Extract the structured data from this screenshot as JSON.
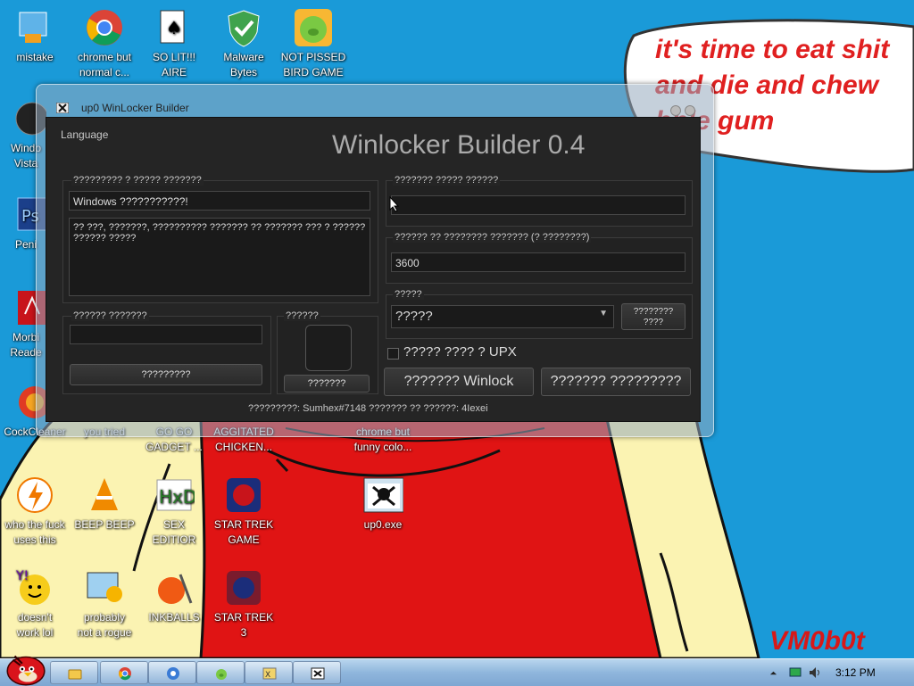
{
  "desktop": {
    "bubble_text": [
      "it's time to eat shit",
      "and die and chew",
      "bble gum"
    ],
    "signature": "VM0b0t",
    "icons": [
      {
        "name": "mistake-icon",
        "label": "mistake"
      },
      {
        "name": "chrome-icon",
        "label": "chrome but\nnormal c..."
      },
      {
        "name": "solitaire-icon",
        "label": "SO LIT!!!\nAIRE"
      },
      {
        "name": "malwarebytes-icon",
        "label": "Malware\nBytes"
      },
      {
        "name": "pig-icon",
        "label": "NOT PISSED\nBIRD GAME"
      },
      {
        "name": "windows-vista-icon",
        "label": "Windo\nVista"
      },
      {
        "name": "photoshop-icon",
        "label": "Peni"
      },
      {
        "name": "pdf-reader-icon",
        "label": "Morbi\nReade"
      },
      {
        "name": "ccleaner-icon",
        "label": "CockCleaner"
      },
      {
        "name": "you-tried-icon",
        "label": "you tried"
      },
      {
        "name": "gadget-icon",
        "label": "GO GO\nGADGET ..."
      },
      {
        "name": "chicken-icon",
        "label": "AGGITATED\nCHICKEN..."
      },
      {
        "name": "chrome-funny-icon",
        "label": "chrome but\nfunny colo..."
      },
      {
        "name": "avast-icon",
        "label": "who the fuck\nuses this"
      },
      {
        "name": "vlc-icon",
        "label": "BEEP BEEP"
      },
      {
        "name": "hxd-icon",
        "label": "SEX\nEDITIOR"
      },
      {
        "name": "star-trek-icon",
        "label": "STAR TREK\nGAME"
      },
      {
        "name": "up0-exe-icon",
        "label": "up0.exe"
      },
      {
        "name": "yahoo-icon",
        "label": "doesn't\nwork lol"
      },
      {
        "name": "not-a-rogue-icon",
        "label": "probably\nnot a rogue"
      },
      {
        "name": "inkball-icon",
        "label": "INKBALLS"
      },
      {
        "name": "star-trek-3-icon",
        "label": "STAR TREK\n3"
      }
    ]
  },
  "window": {
    "title": "up0 WinLocker Builder",
    "menu_language": "Language",
    "heading": "Winlocker Builder 0.4",
    "left_group_caption": "????????? ? ????? ???????",
    "title_field": "Windows ???????????!",
    "message_field": "?? ???, ???????, ?????????? ??????? ?? ??????? ??? ? ?????? ?????? ?????",
    "right_group1_caption": "??????? ????? ??????",
    "unlock_code_field": "",
    "timer_caption": "?????? ?? ???????? ??????? (? ????????)",
    "timer_value": "3600",
    "sound_caption": "?????",
    "sound_select": "?????",
    "sound_button": "????????\n????",
    "image_caption": "?????? ???????",
    "image_field": "",
    "image_button": "?????????",
    "icon_caption": "??????",
    "icon_button": "???????",
    "upx_checkbox": "????? ???? ? UPX",
    "build_button": "??????? Winlock",
    "other_button": "??????? ?????????",
    "credits": "?????????: Sumhex#7148 ??????? ?? ??????: 4Iexei"
  },
  "taskbar": {
    "clock": "3:12 PM"
  },
  "colors": {
    "desktop_bg": "#1a9ad8",
    "bubble_text": "#e02020",
    "shirt_red": "#e01414",
    "skin_yellow": "#fbf3b2"
  }
}
